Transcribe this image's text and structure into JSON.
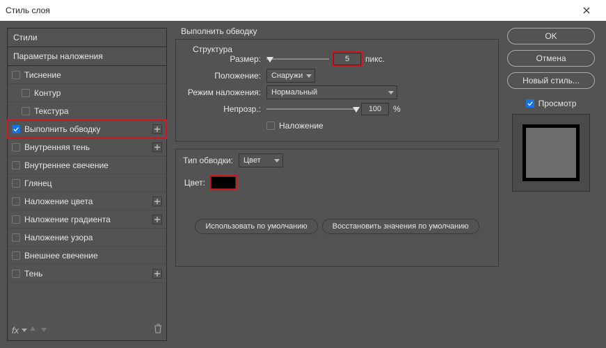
{
  "window": {
    "title": "Стиль слоя"
  },
  "sidebar": {
    "styles": "Стили",
    "blending": "Параметры наложения",
    "items": [
      {
        "label": "Тиснение",
        "plus": false
      },
      {
        "label": "Контур",
        "plus": false,
        "indent": true
      },
      {
        "label": "Текстура",
        "plus": false,
        "indent": true
      },
      {
        "label": "Выполнить обводку",
        "plus": true,
        "checked": true,
        "highlight": true
      },
      {
        "label": "Внутренняя тень",
        "plus": true
      },
      {
        "label": "Внутреннее свечение",
        "plus": false
      },
      {
        "label": "Глянец",
        "plus": false
      },
      {
        "label": "Наложение цвета",
        "plus": true
      },
      {
        "label": "Наложение градиента",
        "plus": true
      },
      {
        "label": "Наложение узора",
        "plus": false
      },
      {
        "label": "Внешнее свечение",
        "plus": false
      },
      {
        "label": "Тень",
        "plus": true
      }
    ],
    "fx": "fx"
  },
  "panel": {
    "title": "Выполнить обводку",
    "structure": {
      "title": "Структура",
      "size_label": "Размер:",
      "size_value": "5",
      "size_unit": "пикс.",
      "position_label": "Положение:",
      "position_value": "Снаружи",
      "blend_label": "Режим наложения:",
      "blend_value": "Нормальный",
      "opacity_label": "Непрозр.:",
      "opacity_value": "100",
      "opacity_unit": "%",
      "overprint_label": "Наложение"
    },
    "stroke": {
      "type_label": "Тип обводки:",
      "type_value": "Цвет",
      "color_label": "Цвет:",
      "color_value": "#000000"
    },
    "buttons": {
      "default": "Использовать по умолчанию",
      "reset": "Восстановить значения по умолчанию"
    }
  },
  "right": {
    "ok": "OK",
    "cancel": "Отмена",
    "newstyle": "Новый стиль...",
    "preview": "Просмотр"
  }
}
